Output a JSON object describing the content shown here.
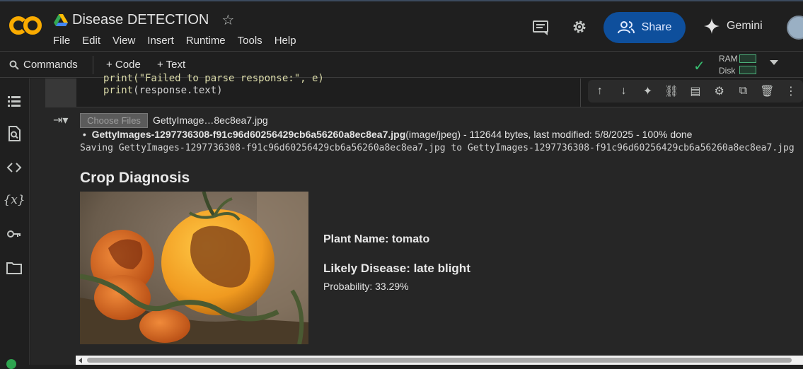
{
  "header": {
    "title": "Disease DETECTION",
    "menu": [
      "File",
      "Edit",
      "View",
      "Insert",
      "Runtime",
      "Tools",
      "Help"
    ],
    "share_label": "Share",
    "gemini_label": "Gemini"
  },
  "toolbar": {
    "commands_label": "Commands",
    "code_label": "+ Code",
    "text_label": "+ Text",
    "ram_label": "RAM",
    "disk_label": "Disk"
  },
  "cell": {
    "code_line1": "print(\"Failed to parse response:\", e)",
    "code_line2_fn": "print",
    "code_line2_rest": "(response.text)"
  },
  "output": {
    "choose_files_label": "Choose Files",
    "chosen_file": "GettyImage…8ec8ea7.jpg",
    "file_name": "GettyImages-1297736308-f91c96d60256429cb6a56260a8ec8ea7.jpg",
    "file_meta": "(image/jpeg) - 112644 bytes, last modified: 5/8/2025 - 100% done",
    "saving_line": "Saving GettyImages-1297736308-f91c96d60256429cb6a56260a8ec8ea7.jpg to GettyImages-1297736308-f91c96d60256429cb6a56260a8ec8ea7.jpg",
    "heading": "Crop Diagnosis",
    "plant_name": "Plant Name: tomato",
    "likely_disease": "Likely Disease: late blight",
    "probability": "Probability: 33.29%"
  },
  "colors": {
    "share_bg": "#0e4f9c",
    "accent_orange": "#f9ab00",
    "status_green": "#38c172"
  }
}
